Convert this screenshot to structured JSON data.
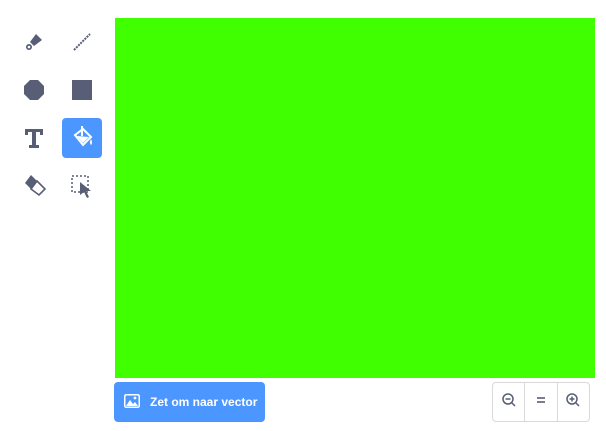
{
  "tools": [
    {
      "name": "brush-tool",
      "icon": "brush-icon",
      "active": false
    },
    {
      "name": "line-tool",
      "icon": "line-icon",
      "active": false
    },
    {
      "name": "circle-tool",
      "icon": "circle-icon",
      "active": false
    },
    {
      "name": "rectangle-tool",
      "icon": "rectangle-icon",
      "active": false
    },
    {
      "name": "text-tool",
      "icon": "text-icon",
      "active": false
    },
    {
      "name": "fill-tool",
      "icon": "fill-bucket-icon",
      "active": true
    },
    {
      "name": "eraser-tool",
      "icon": "eraser-icon",
      "active": false
    },
    {
      "name": "select-tool",
      "icon": "select-icon",
      "active": false
    }
  ],
  "canvas": {
    "fill_color": "#40ff00"
  },
  "convert_button": {
    "label": "Zet om naar vector",
    "icon": "image-icon"
  },
  "zoom": {
    "zoom_out_icon": "zoom-out-icon",
    "reset_icon": "zoom-reset-icon",
    "zoom_in_icon": "zoom-in-icon"
  },
  "colors": {
    "accent": "#4c97ff",
    "icon": "#575e75",
    "canvas": "#40ff00"
  }
}
